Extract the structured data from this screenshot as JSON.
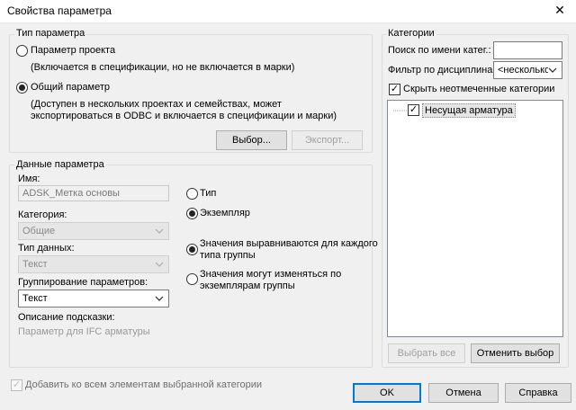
{
  "window": {
    "title": "Свойства параметра"
  },
  "param_type": {
    "legend": "Тип параметра",
    "project_label": "Параметр проекта",
    "project_desc": "(Включается в спецификации, но не включается в марки)",
    "shared_label": "Общий параметр",
    "shared_desc_1": "(Доступен в нескольких проектах и семействах, может",
    "shared_desc_2": "экспортироваться в ODBC и включается в спецификации и марки)",
    "select_button": "Выбор...",
    "export_button": "Экспорт...",
    "selected": "shared"
  },
  "param_data": {
    "legend": "Данные параметра",
    "name_label": "Имя:",
    "name_value": "ADSK_Метка основы",
    "category_label": "Категория:",
    "category_value": "Общие",
    "datatype_label": "Тип данных:",
    "datatype_value": "Текст",
    "grouping_label": "Группирование параметров:",
    "grouping_value": "Текст",
    "tooltip_label": "Описание подсказки:",
    "tooltip_value": "Параметр для IFC арматуры",
    "type_label": "Тип",
    "instance_label": "Экземпляр",
    "align_label_1": "Значения выравниваются для каждого",
    "align_label_2": "типа группы",
    "vary_label_1": "Значения могут изменяться по",
    "vary_label_2": "экземплярам группы"
  },
  "categories": {
    "legend": "Категории",
    "search_label": "Поиск по имени катег.:",
    "search_value": "",
    "filter_label": "Фильтр по дисциплинам:",
    "filter_value": "<несколько>",
    "hide_unchecked_label": "Скрыть неотмеченные категории",
    "tree_items": [
      {
        "label": "Несущая арматура",
        "checked": true
      }
    ],
    "select_all_button": "Выбрать все",
    "deselect_button": "Отменить выбор"
  },
  "footer": {
    "add_all_label": "Добавить ко всем элементам выбранной категории",
    "ok_button": "OK",
    "cancel_button": "Отмена",
    "help_button": "Справка"
  }
}
